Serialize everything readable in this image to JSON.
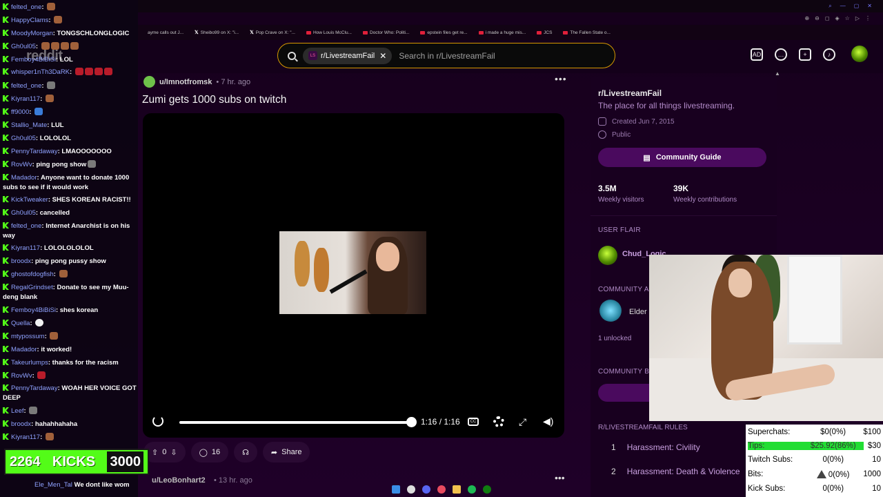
{
  "bookmarks": [
    {
      "icon": "x-icon",
      "label": "Sheibo99 on X: \"i..."
    },
    {
      "icon": "x-icon",
      "label": "Pop Crave on X: \"..."
    },
    {
      "icon": "youtube-icon",
      "label": "How Louis McClu..."
    },
    {
      "icon": "youtube-icon",
      "label": "Doctor Who: Politi..."
    },
    {
      "icon": "youtube-icon",
      "label": "epstein files get re..."
    },
    {
      "icon": "youtube-icon",
      "label": "i made a huge mis..."
    },
    {
      "icon": "youtube-icon",
      "label": "JCS"
    },
    {
      "icon": "youtube-icon",
      "label": "The Fallen State o..."
    }
  ],
  "bookmark_partial": "ayme calls out J...",
  "search": {
    "subreddit_chip": "r/LivestreamFail",
    "placeholder": "Search in r/LivestreamFail"
  },
  "post": {
    "user": "u/Imnotfromsk",
    "time": "7 hr. ago",
    "title": "Zumi gets 1000 subs on twitch",
    "video_time": "1:16 / 1:16",
    "video_progress": 1.0,
    "votes": "0",
    "comments": "16",
    "share": "Share"
  },
  "next_post": {
    "user": "u/LeoBonhart2",
    "time": "13 hr. ago"
  },
  "sidebar": {
    "name": "r/LivestreamFail",
    "description": "The place for all things livestreaming.",
    "created": "Created Jun 7, 2015",
    "visibility": "Public",
    "guide_button": "Community Guide",
    "stats": [
      {
        "value": "3.5M",
        "label": "Weekly visitors"
      },
      {
        "value": "39K",
        "label": "Weekly contributions"
      }
    ],
    "flair_heading": "USER FLAIR",
    "flair_name": "Chud_Logic",
    "achievements_heading": "COMMUNITY A",
    "achievement_name": "Elder",
    "unlocked": "1 unlocked",
    "bookmarks_heading": "COMMUNITY B",
    "rules_heading": "R/LIVESTREAMFAIL RULES",
    "rules": [
      {
        "n": "1",
        "text": "Harassment: Civility"
      },
      {
        "n": "2",
        "text": "Harassment: Death & Violence"
      }
    ]
  },
  "chat": {
    "watermark": "reddit",
    "messages": [
      {
        "user": "felted_one",
        "text": "",
        "emotes": [
          "brown"
        ]
      },
      {
        "user": "HappyClams",
        "text": "",
        "emotes": [
          "brown"
        ]
      },
      {
        "user": "MoodyMorgan",
        "text": "TONGSCHLONGLOGIC",
        "emotes": []
      },
      {
        "user": "Gh0ul05",
        "text": "",
        "emotes": [
          "brown",
          "brown",
          "brown",
          "brown"
        ]
      },
      {
        "user": "Femboy4BiBiSi",
        "text": "LOL",
        "emotes": []
      },
      {
        "user": "whisper1nTh3DaRK",
        "text": "",
        "emotes": [
          "red",
          "red",
          "red",
          "red"
        ]
      },
      {
        "user": "felted_one",
        "text": "",
        "emotes": [
          "gray"
        ]
      },
      {
        "user": "Kiyran117",
        "text": "",
        "emotes": [
          "brown"
        ]
      },
      {
        "user": "ff9000",
        "text": "",
        "emotes": [
          "blue"
        ]
      },
      {
        "user": "Stallio_Mate",
        "text": "LUL",
        "emotes": []
      },
      {
        "user": "Gh0ul05",
        "text": "LOLOLOL",
        "emotes": []
      },
      {
        "user": "PennyTardaway",
        "text": "LMAOOOOOOO",
        "emotes": []
      },
      {
        "user": "RovWv",
        "text": "ping pong show",
        "emotes": [
          "gray"
        ]
      },
      {
        "user": "Madador",
        "text": "Anyone want to donate 1000 subs to see if it would work",
        "emotes": []
      },
      {
        "user": "KickTweaker",
        "text": "SHES KOREAN RACIST!!",
        "emotes": []
      },
      {
        "user": "Gh0ul05",
        "text": "cancelled",
        "emotes": []
      },
      {
        "user": "felted_one",
        "text": "Internet Anarchist is on his way",
        "emotes": []
      },
      {
        "user": "Kiyran117",
        "text": "LOLOLOLOLOL",
        "emotes": []
      },
      {
        "user": "broodx",
        "text": "ping pong pussy show",
        "emotes": []
      },
      {
        "user": "ghostofdogfish",
        "text": "",
        "emotes": [
          "brown"
        ]
      },
      {
        "user": "RegalGrindset",
        "text": "Donate to see my Muu-deng blank",
        "emotes": []
      },
      {
        "user": "Femboy4BiBiSi",
        "text": "shes korean",
        "emotes": []
      },
      {
        "user": "Quella",
        "text": "",
        "emotes": [
          "white"
        ]
      },
      {
        "user": "mtypossum",
        "text": "",
        "emotes": [
          "brown"
        ]
      },
      {
        "user": "Madador",
        "text": "it worked!",
        "emotes": []
      },
      {
        "user": "Takeurlumps",
        "text": "thanks for the racism",
        "emotes": []
      },
      {
        "user": "RovWv",
        "text": "",
        "emotes": [
          "red"
        ]
      },
      {
        "user": "PennyTardaway",
        "text": "WOAH HER VOICE GOT DEEP",
        "emotes": []
      },
      {
        "user": "Leef",
        "text": "",
        "emotes": [
          "gray"
        ]
      },
      {
        "user": "broodx",
        "text": "hahahhahaha",
        "emotes": []
      },
      {
        "user": "Kiyran117",
        "text": "",
        "emotes": [
          "brown"
        ]
      }
    ],
    "last_message": {
      "user": "Ele_Men_Tal",
      "text": "We dont like wom"
    }
  },
  "kicks_goal": {
    "current": "2264",
    "label": "KICKS",
    "goal": "3000"
  },
  "donations": [
    {
      "name": "Superchats:",
      "value": "$0(0%)",
      "goal": "$100",
      "highlight": false
    },
    {
      "name": "Tips:",
      "value": "$25.92(86%)",
      "goal": "$30",
      "highlight": true
    },
    {
      "name": "Twitch Subs:",
      "value": "0(0%)",
      "goal": "10",
      "highlight": false
    },
    {
      "name": "Bits:",
      "value": "0(0%)",
      "goal": "1000",
      "highlight": false
    },
    {
      "name": "Kick Subs:",
      "value": "0(0%)",
      "goal": "10",
      "highlight": false
    }
  ],
  "colors": {
    "kick_green": "#53fc18",
    "search_border": "#d89a00",
    "accent_purple": "#4a0a5e",
    "tips_green": "#22dd33"
  }
}
